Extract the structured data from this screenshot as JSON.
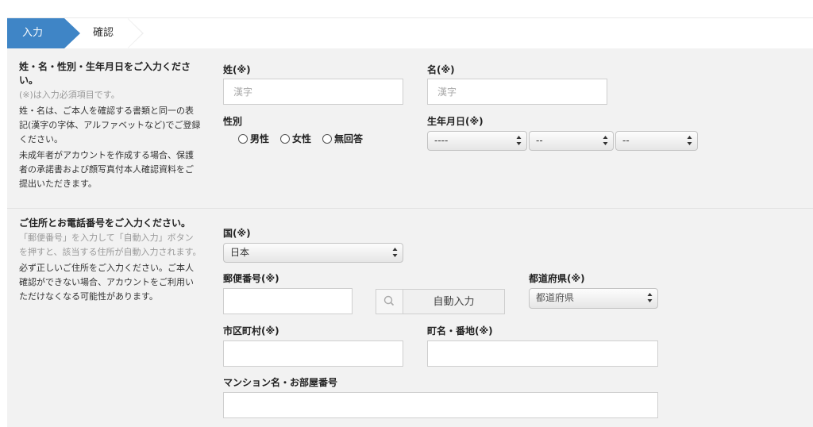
{
  "steps": {
    "active": "入力",
    "next": "確認"
  },
  "section1": {
    "heading": "姓・名・性別・生年月日をご入力ください。",
    "required_note": "(※)は入力必須項目です。",
    "note1": "姓・名は、ご本人を確認する書類と同一の表記(漢字の字体、アルファベットなど)でご登録ください。",
    "note2": "未成年者がアカウントを作成する場合、保護者の承諾書および顔写真付本人確認資料をご提出いただきます。",
    "last_name_label": "姓(※)",
    "last_name_placeholder": "漢字",
    "first_name_label": "名(※)",
    "first_name_placeholder": "漢字",
    "gender_label": "性別",
    "gender_options": [
      "男性",
      "女性",
      "無回答"
    ],
    "birthdate_label": "生年月日(※)",
    "year_value": "----",
    "month_value": "--",
    "day_value": "--"
  },
  "section2": {
    "heading": "ご住所とお電話番号をご入力ください。",
    "note_gray": "「郵便番号」を入力して「自動入力」ボタンを押すと、該当する住所が自動入力されます。",
    "note": "必ず正しいご住所をご入力ください。ご本人確認ができない場合、アカウントをご利用いただけなくなる可能性があります。",
    "country_label": "国(※)",
    "country_value": "日本",
    "postal_label": "郵便番号(※)",
    "autofill_label": "自動入力",
    "prefecture_label": "都道府県(※)",
    "prefecture_value": "都道府県",
    "city_label": "市区町村(※)",
    "town_label": "町名・番地(※)",
    "building_label": "マンション名・お部屋番号"
  }
}
